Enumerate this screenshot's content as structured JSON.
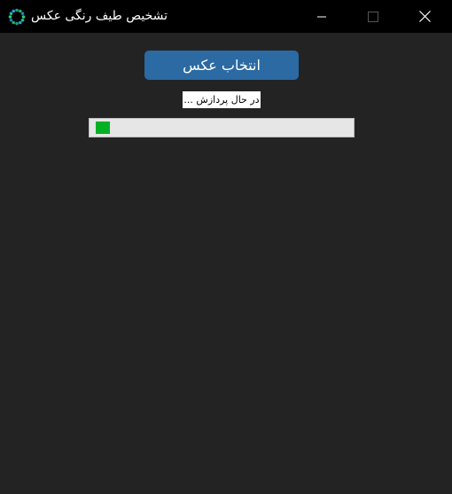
{
  "window": {
    "title": "تشخیص طیف رنگی عکس",
    "icon": "circular-spectrum-icon",
    "controls": [
      "minimize-icon",
      "maximize-icon",
      "close-icon"
    ]
  },
  "main": {
    "select_button_label": "انتخاب عکس",
    "status_text": "در حال پردازش ...",
    "progress": {
      "value_fraction": 0.05,
      "mode": "busy",
      "fill_color": "#06b025"
    }
  },
  "colors": {
    "background": "#232323",
    "titlebar": "#000000",
    "button": "#2b6aa3"
  }
}
